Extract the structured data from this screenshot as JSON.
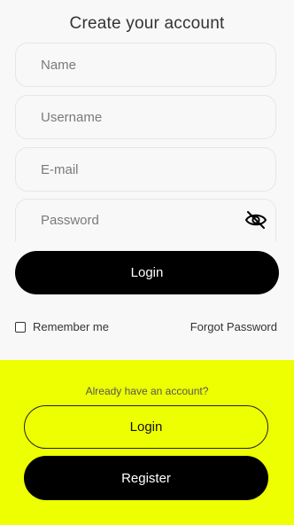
{
  "header": {
    "title": "Create your account"
  },
  "form": {
    "name": {
      "placeholder": "Name",
      "value": ""
    },
    "username": {
      "placeholder": "Username",
      "value": ""
    },
    "email": {
      "placeholder": "E-mail",
      "value": ""
    },
    "password": {
      "placeholder": "Password",
      "value": "",
      "toggle_icon": "eye-off-icon"
    },
    "submit_label": "Login",
    "remember_label": "Remember me",
    "remember_checked": false,
    "forgot_label": "Forgot Password"
  },
  "footer": {
    "prompt": "Already have an account?",
    "login_label": "Login",
    "register_label": "Register"
  },
  "colors": {
    "accent": "#EDFF00",
    "primary": "#000000"
  }
}
